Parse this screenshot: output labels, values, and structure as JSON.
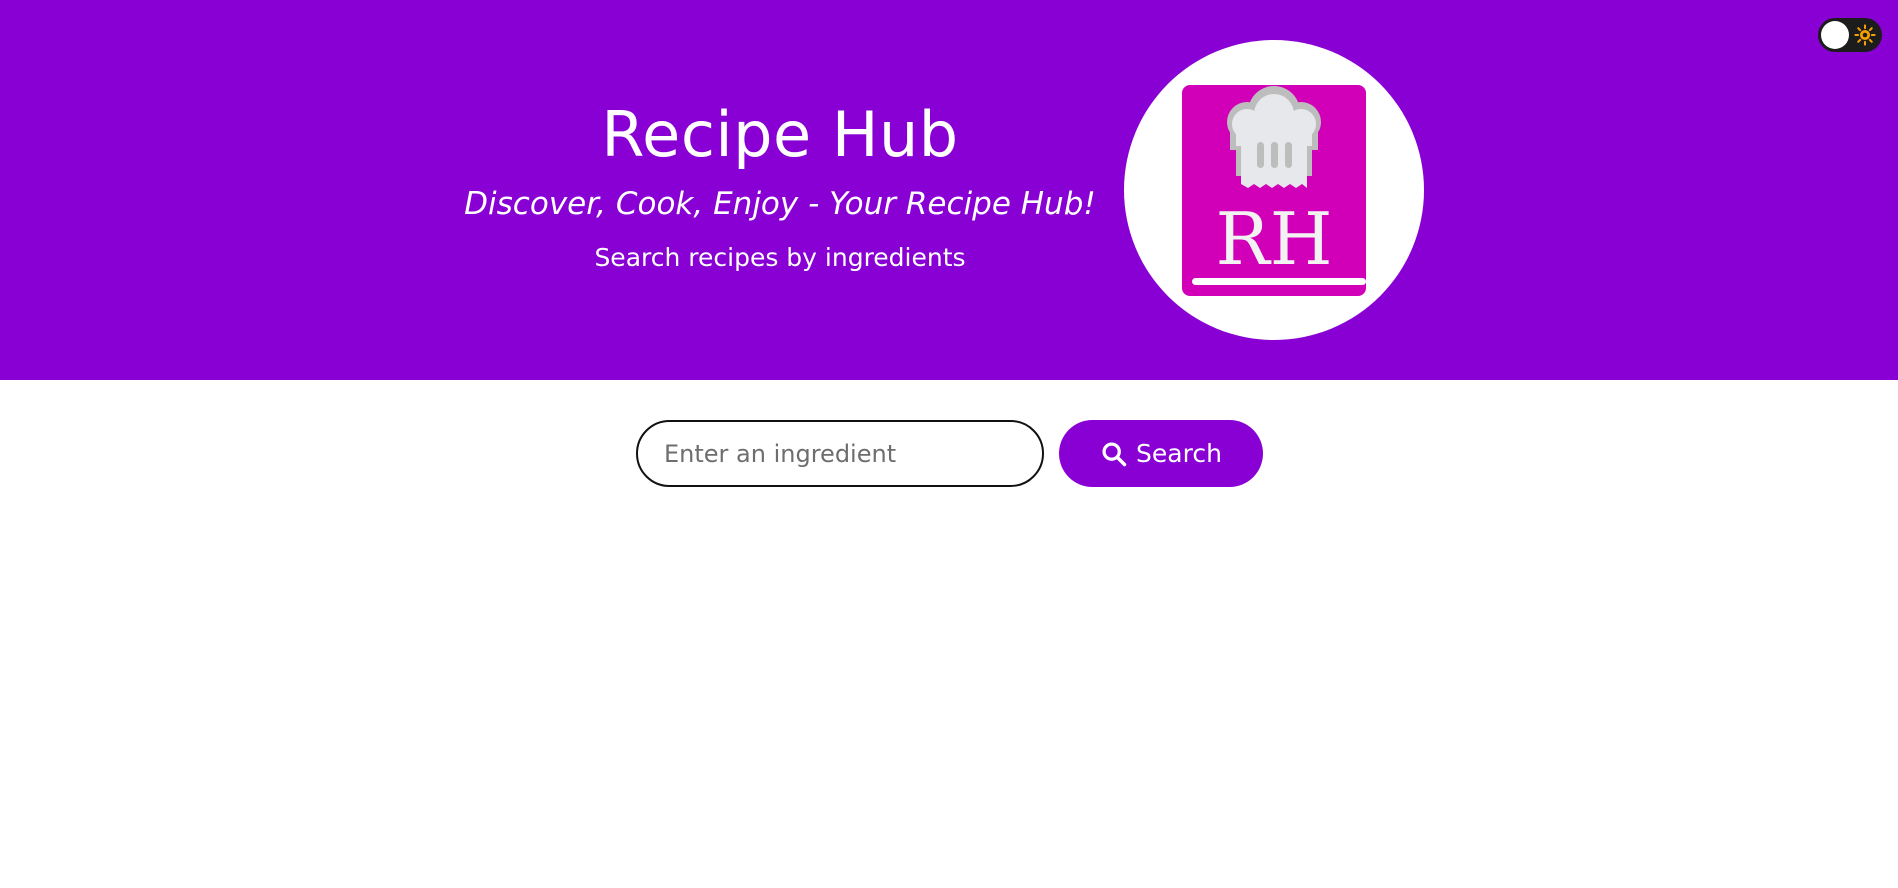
{
  "header": {
    "title": "Recipe Hub",
    "tagline": "Discover, Cook, Enjoy - Your Recipe Hub!",
    "subtitle": "Search recipes by ingredients",
    "background_color": "#8800d4"
  },
  "logo": {
    "text": "RH",
    "book_color": "#d100b8",
    "icon": "chef-hat-icon"
  },
  "theme_toggle": {
    "icon": "sun-icon",
    "state": "light"
  },
  "search": {
    "placeholder": "Enter an ingredient",
    "value": "",
    "button_label": "Search",
    "button_icon": "search-icon",
    "accent_color": "#8800d4"
  }
}
